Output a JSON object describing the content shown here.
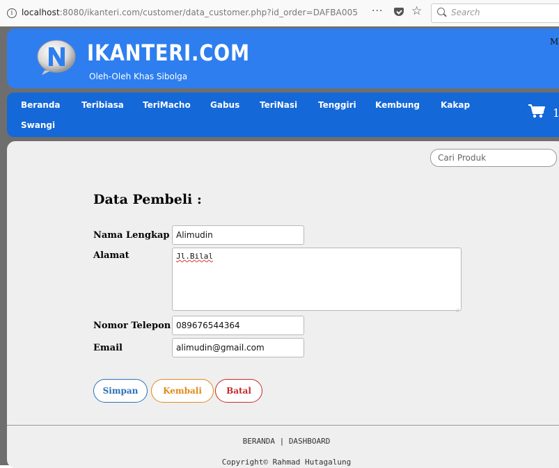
{
  "browser": {
    "url_host": "localhost",
    "url_rest": ":8080/ikanteri.com/customer/data_customer.php?id_order=DAFBA005",
    "more_label": "···",
    "search_placeholder": "Search"
  },
  "header": {
    "brand": "IKANTERI.COM",
    "tagline": "Oleh-Oleh Khas Sibolga",
    "login_label": "Masuk"
  },
  "nav": {
    "items": [
      "Beranda",
      "Teribiasa",
      "TeriMacho",
      "Gabus",
      "TeriNasi",
      "Tenggiri",
      "Kembung",
      "Kakap",
      "Swangi"
    ],
    "cart_count": "1"
  },
  "search": {
    "placeholder": "Cari Produk"
  },
  "form": {
    "title": "Data Pembeli :",
    "name_label": "Nama Lengkap",
    "name_value": "Alimudin",
    "address_label": "Alamat",
    "address_value": "Jl.Bilal",
    "phone_label": "Nomor Telepon",
    "phone_value": "089676544364",
    "email_label": "Email",
    "email_value": "alimudin@gmail.com"
  },
  "buttons": {
    "save": "Simpan",
    "back": "Kembali",
    "cancel": "Batal"
  },
  "footer": {
    "links": [
      "BERANDA",
      "DASHBOARD"
    ],
    "separator": "|",
    "copyright": "Copyright© Rahmad Hutagalung"
  },
  "colors": {
    "header_blue": "#2e7eef",
    "nav_blue": "#1468d8",
    "save": "#2a6fb8",
    "back": "#e08a16",
    "cancel": "#c62828"
  }
}
